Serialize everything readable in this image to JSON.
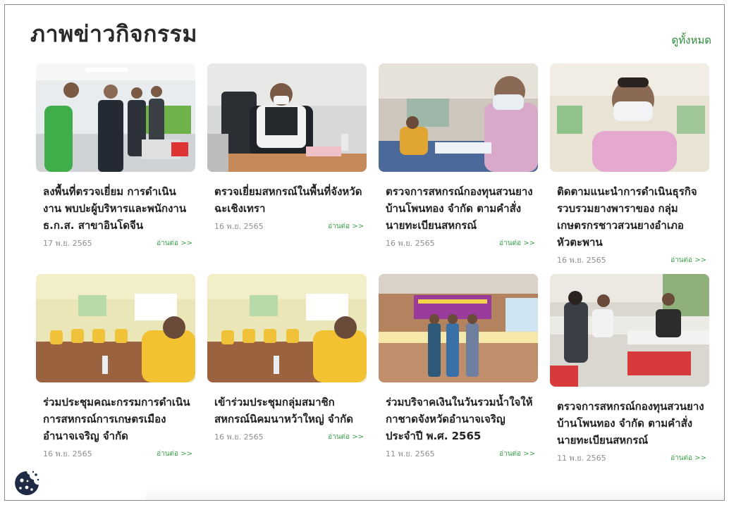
{
  "section": {
    "title": "ภาพข่าวกิจกรรม",
    "view_all_label": "ดูทั้งหมด"
  },
  "cards": [
    {
      "title": "ลงพื้นที่ตรวจเยี่ยม การดำเนินงาน พบปะผู้บริหารและพนักงาน ธ.ก.ส. สาขาอินโดจีน",
      "date": "17 พ.ย. 2565",
      "read_more": "อ่านต่อ >>",
      "image": "officials-visit-bank-photo"
    },
    {
      "title": "ตรวจเยี่ยมสหกรณ์ในพื้นที่จังหวัดฉะเชิงเทรา",
      "date": "16 พ.ย. 2565",
      "read_more": "อ่านต่อ >>",
      "image": "official-at-desk-photo"
    },
    {
      "title": "ตรวจการสหกรณ์กองทุนสวนยางบ้านโพนทอง จำกัด ตามคำสั่งนายทะเบียนสหกรณ์",
      "date": "16 พ.ย. 2565",
      "read_more": "อ่านต่อ >>",
      "image": "man-writing-documents-photo"
    },
    {
      "title": "ติดตามแนะนำการดำเนินธุรกิจรวบรวมยางพาราของ กลุ่มเกษตรกรชาวสวนยางอำเภอหัวตะพาน",
      "date": "16 พ.ย. 2565",
      "read_more": "อ่านต่อ >>",
      "image": "man-selfie-mask-photo"
    },
    {
      "title": "ร่วมประชุมคณะกรรมการดำเนินการสหกรณ์การเกษตรเมืองอำนาจเจริญ จำกัด",
      "date": "16 พ.ย. 2565",
      "read_more": "อ่านต่อ >>",
      "image": "meeting-room-photo"
    },
    {
      "title": "เข้าร่วมประชุมกลุ่มสมาชิกสหกรณ์นิคมนาหว้าใหญ่ จำกัด",
      "date": "16 พ.ย. 2565",
      "read_more": "อ่านต่อ >>",
      "image": "meeting-room-photo-2"
    },
    {
      "title": "ร่วมบริจาคเงินในวันรวมน้ำใจให้กาชาดจังหวัดอำนาจเจริญ ประจำปี พ.ศ. 2565",
      "date": "11 พ.ย. 2565",
      "read_more": "อ่านต่อ >>",
      "image": "three-men-stage-photo"
    },
    {
      "title": "ตรวจการสหกรณ์กองทุนสวนยางบ้านโพนทอง จำกัด ตามคำสั่งนายทะเบียนสหกรณ์",
      "date": "11 พ.ย. 2565",
      "read_more": "อ่านต่อ >>",
      "image": "outdoor-table-meeting-photo"
    }
  ],
  "cookie": {
    "icon": "cookie-icon"
  },
  "colors": {
    "accent_green": "#2e8b3a",
    "read_more_green": "#3aa04a",
    "date_gray": "#8f8f8f",
    "title_dark": "#2a2a2a"
  }
}
